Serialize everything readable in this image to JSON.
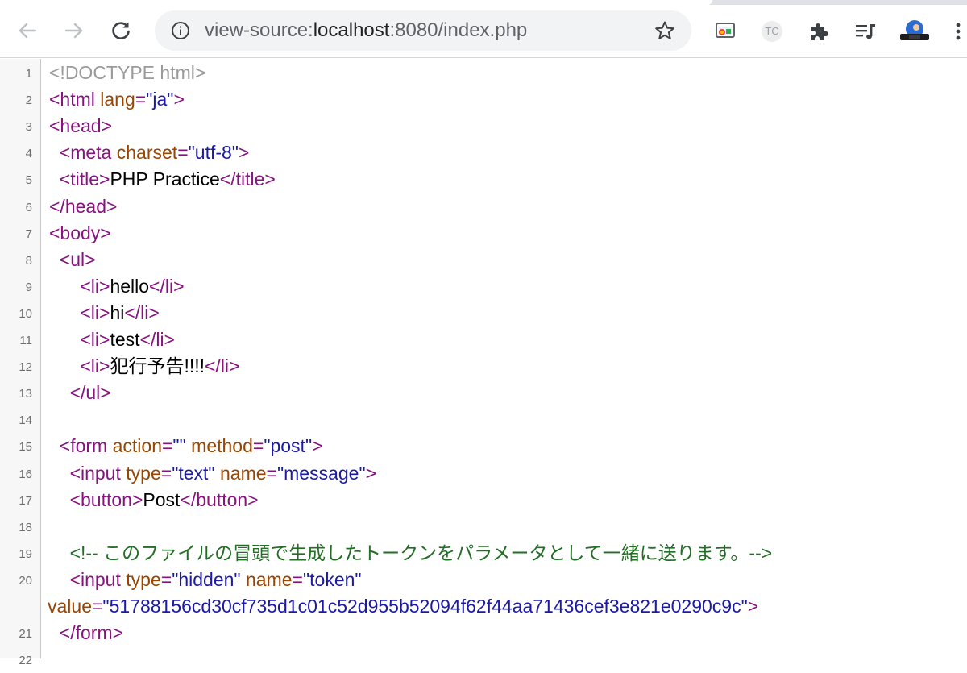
{
  "browser": {
    "url_prefix": "view-source:",
    "url_host": "localhost",
    "url_rest": ":8080/index.php",
    "extension_tc_label": "TC"
  },
  "source_lines": [
    {
      "num": "1",
      "indent": "",
      "tokens": [
        [
          "doc",
          "<!DOCTYPE html>"
        ]
      ]
    },
    {
      "num": "2",
      "indent": "",
      "tokens": [
        [
          "tag",
          "<html "
        ],
        [
          "attr",
          "lang"
        ],
        [
          "tag",
          "="
        ],
        [
          "val",
          "\"ja\""
        ],
        [
          "tag",
          ">"
        ]
      ]
    },
    {
      "num": "3",
      "indent": "",
      "tokens": [
        [
          "tag",
          "<head>"
        ]
      ]
    },
    {
      "num": "4",
      "indent": "  ",
      "tokens": [
        [
          "tag",
          "<meta "
        ],
        [
          "attr",
          "charset"
        ],
        [
          "tag",
          "="
        ],
        [
          "val",
          "\"utf-8\""
        ],
        [
          "tag",
          ">"
        ]
      ]
    },
    {
      "num": "5",
      "indent": "  ",
      "tokens": [
        [
          "tag",
          "<title>"
        ],
        [
          "text",
          "PHP Practice"
        ],
        [
          "tag",
          "</title>"
        ]
      ]
    },
    {
      "num": "6",
      "indent": "",
      "tokens": [
        [
          "tag",
          "</head>"
        ]
      ]
    },
    {
      "num": "7",
      "indent": "",
      "tokens": [
        [
          "tag",
          "<body>"
        ]
      ]
    },
    {
      "num": "8",
      "indent": "  ",
      "tokens": [
        [
          "tag",
          "<ul>"
        ]
      ]
    },
    {
      "num": "9",
      "indent": "      ",
      "tokens": [
        [
          "tag",
          "<li>"
        ],
        [
          "text",
          "hello"
        ],
        [
          "tag",
          "</li>"
        ]
      ]
    },
    {
      "num": "10",
      "indent": "      ",
      "tokens": [
        [
          "tag",
          "<li>"
        ],
        [
          "text",
          "hi"
        ],
        [
          "tag",
          "</li>"
        ]
      ]
    },
    {
      "num": "11",
      "indent": "      ",
      "tokens": [
        [
          "tag",
          "<li>"
        ],
        [
          "text",
          "test"
        ],
        [
          "tag",
          "</li>"
        ]
      ]
    },
    {
      "num": "12",
      "indent": "      ",
      "tokens": [
        [
          "tag",
          "<li>"
        ],
        [
          "text",
          "犯行予告!!!!"
        ],
        [
          "tag",
          "</li>"
        ]
      ]
    },
    {
      "num": "13",
      "indent": "    ",
      "tokens": [
        [
          "tag",
          "</ul>"
        ]
      ]
    },
    {
      "num": "14",
      "indent": "",
      "tokens": []
    },
    {
      "num": "15",
      "indent": "  ",
      "tokens": [
        [
          "tag",
          "<form "
        ],
        [
          "attr",
          "action"
        ],
        [
          "tag",
          "="
        ],
        [
          "val",
          "\"\""
        ],
        [
          "tag",
          " "
        ],
        [
          "attr",
          "method"
        ],
        [
          "tag",
          "="
        ],
        [
          "val",
          "\"post\""
        ],
        [
          "tag",
          ">"
        ]
      ]
    },
    {
      "num": "16",
      "indent": "    ",
      "tokens": [
        [
          "tag",
          "<input "
        ],
        [
          "attr",
          "type"
        ],
        [
          "tag",
          "="
        ],
        [
          "val",
          "\"text\""
        ],
        [
          "tag",
          " "
        ],
        [
          "attr",
          "name"
        ],
        [
          "tag",
          "="
        ],
        [
          "val",
          "\"message\""
        ],
        [
          "tag",
          ">"
        ]
      ]
    },
    {
      "num": "17",
      "indent": "    ",
      "tokens": [
        [
          "tag",
          "<button>"
        ],
        [
          "text",
          "Post"
        ],
        [
          "tag",
          "</button>"
        ]
      ]
    },
    {
      "num": "18",
      "indent": "",
      "tokens": []
    },
    {
      "num": "19",
      "indent": "    ",
      "tokens": [
        [
          "comment",
          "<!-- このファイルの冒頭で生成したトークンをパラメータとして一緒に送ります。-->"
        ]
      ]
    },
    {
      "num": "20",
      "indent": "    ",
      "tokens": [
        [
          "tag",
          "<input "
        ],
        [
          "attr",
          "type"
        ],
        [
          "tag",
          "="
        ],
        [
          "val",
          "\"hidden\""
        ],
        [
          "tag",
          " "
        ],
        [
          "attr",
          "name"
        ],
        [
          "tag",
          "="
        ],
        [
          "val",
          "\"token\""
        ]
      ]
    },
    {
      "num": "",
      "indent": "",
      "tokens": [
        [
          "attr",
          "value"
        ],
        [
          "tag",
          "="
        ],
        [
          "val",
          "\"51788156cd30cf735d1c01c52d955b52094f62f44aa71436cef3e821e0290c9c\""
        ],
        [
          "tag",
          ">"
        ]
      ]
    },
    {
      "num": "21",
      "indent": "  ",
      "tokens": [
        [
          "tag",
          "</form>"
        ]
      ]
    },
    {
      "num": "22",
      "indent": "",
      "tokens": []
    }
  ]
}
